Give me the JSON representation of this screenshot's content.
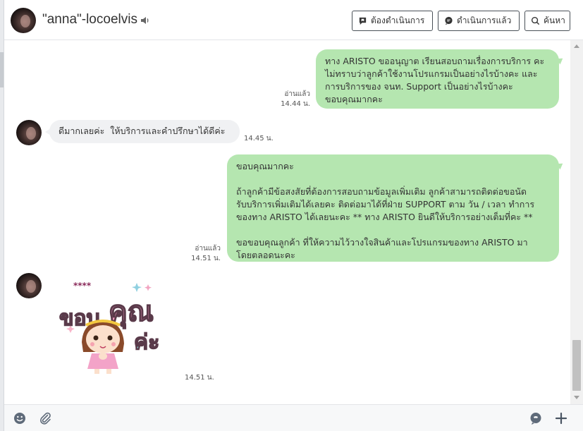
{
  "header": {
    "contact_name": "\"anna\"-locoelvis",
    "btn_todo": "ต้องดำเนินการ",
    "btn_done": "ดำเนินการแล้ว",
    "btn_search": "ค้นหา"
  },
  "messages": [
    {
      "direction": "out",
      "text": "ทาง ARISTO ขออนุญาต เรียนสอบถามเรื่องการบริการ คะ\nไม่ทราบว่าลูกค้าใช้งานโปรแกรมเป็นอย่างไรบ้างคะ และ\nการบริการของ จนท. Support เป็นอย่างไรบ้างคะ\nขอบคุณมากคะ",
      "read": "อ่านแล้ว",
      "time": "14.44 น."
    },
    {
      "direction": "in",
      "text": "ดีมากเลยค่ะ  ให้บริการและคำปรึกษาได้ดีค่ะ",
      "time": "14.45 น."
    },
    {
      "direction": "out",
      "text": "ขอบคุณมากคะ\n\nถ้าลูกค้ามีข้อสงสัยที่ต้องการสอบถามข้อมูลเพิ่มเติม ลูกค้าสามารถติดต่อขอนัด\nรับบริการเพิ่มเติมได้เลยคะ ติดต่อมาได้ที่ฝ่าย SUPPORT ตาม วัน / เวลา ทำการ\nของทาง ARISTO ได้เลยนะคะ ** ทาง ARISTO ยินดีให้บริการอย่างเต็มที่คะ **\n\nขอขอบคุณลูกค้า ที่ให้ความไว้วางใจสินค้าและโปรแกรมของทาง ARISTO มา\nโดยตลอดนะคะ",
      "read": "อ่านแล้ว",
      "time": "14.51 น."
    },
    {
      "direction": "in",
      "sticker_text_1": "ขอบ",
      "sticker_text_2": "คุณ",
      "sticker_text_3": "ค่ะ",
      "time": "14.51 น."
    }
  ],
  "colors": {
    "outgoing_bubble": "#b5e6b0",
    "incoming_bubble": "#f0f1f3",
    "button_border": "#495057"
  },
  "icons": [
    "speaker-icon",
    "bookmark-chat-icon",
    "chat-bubble-icon",
    "search-icon",
    "emoji-icon",
    "paperclip-icon",
    "line-chat-icon",
    "plus-icon"
  ]
}
